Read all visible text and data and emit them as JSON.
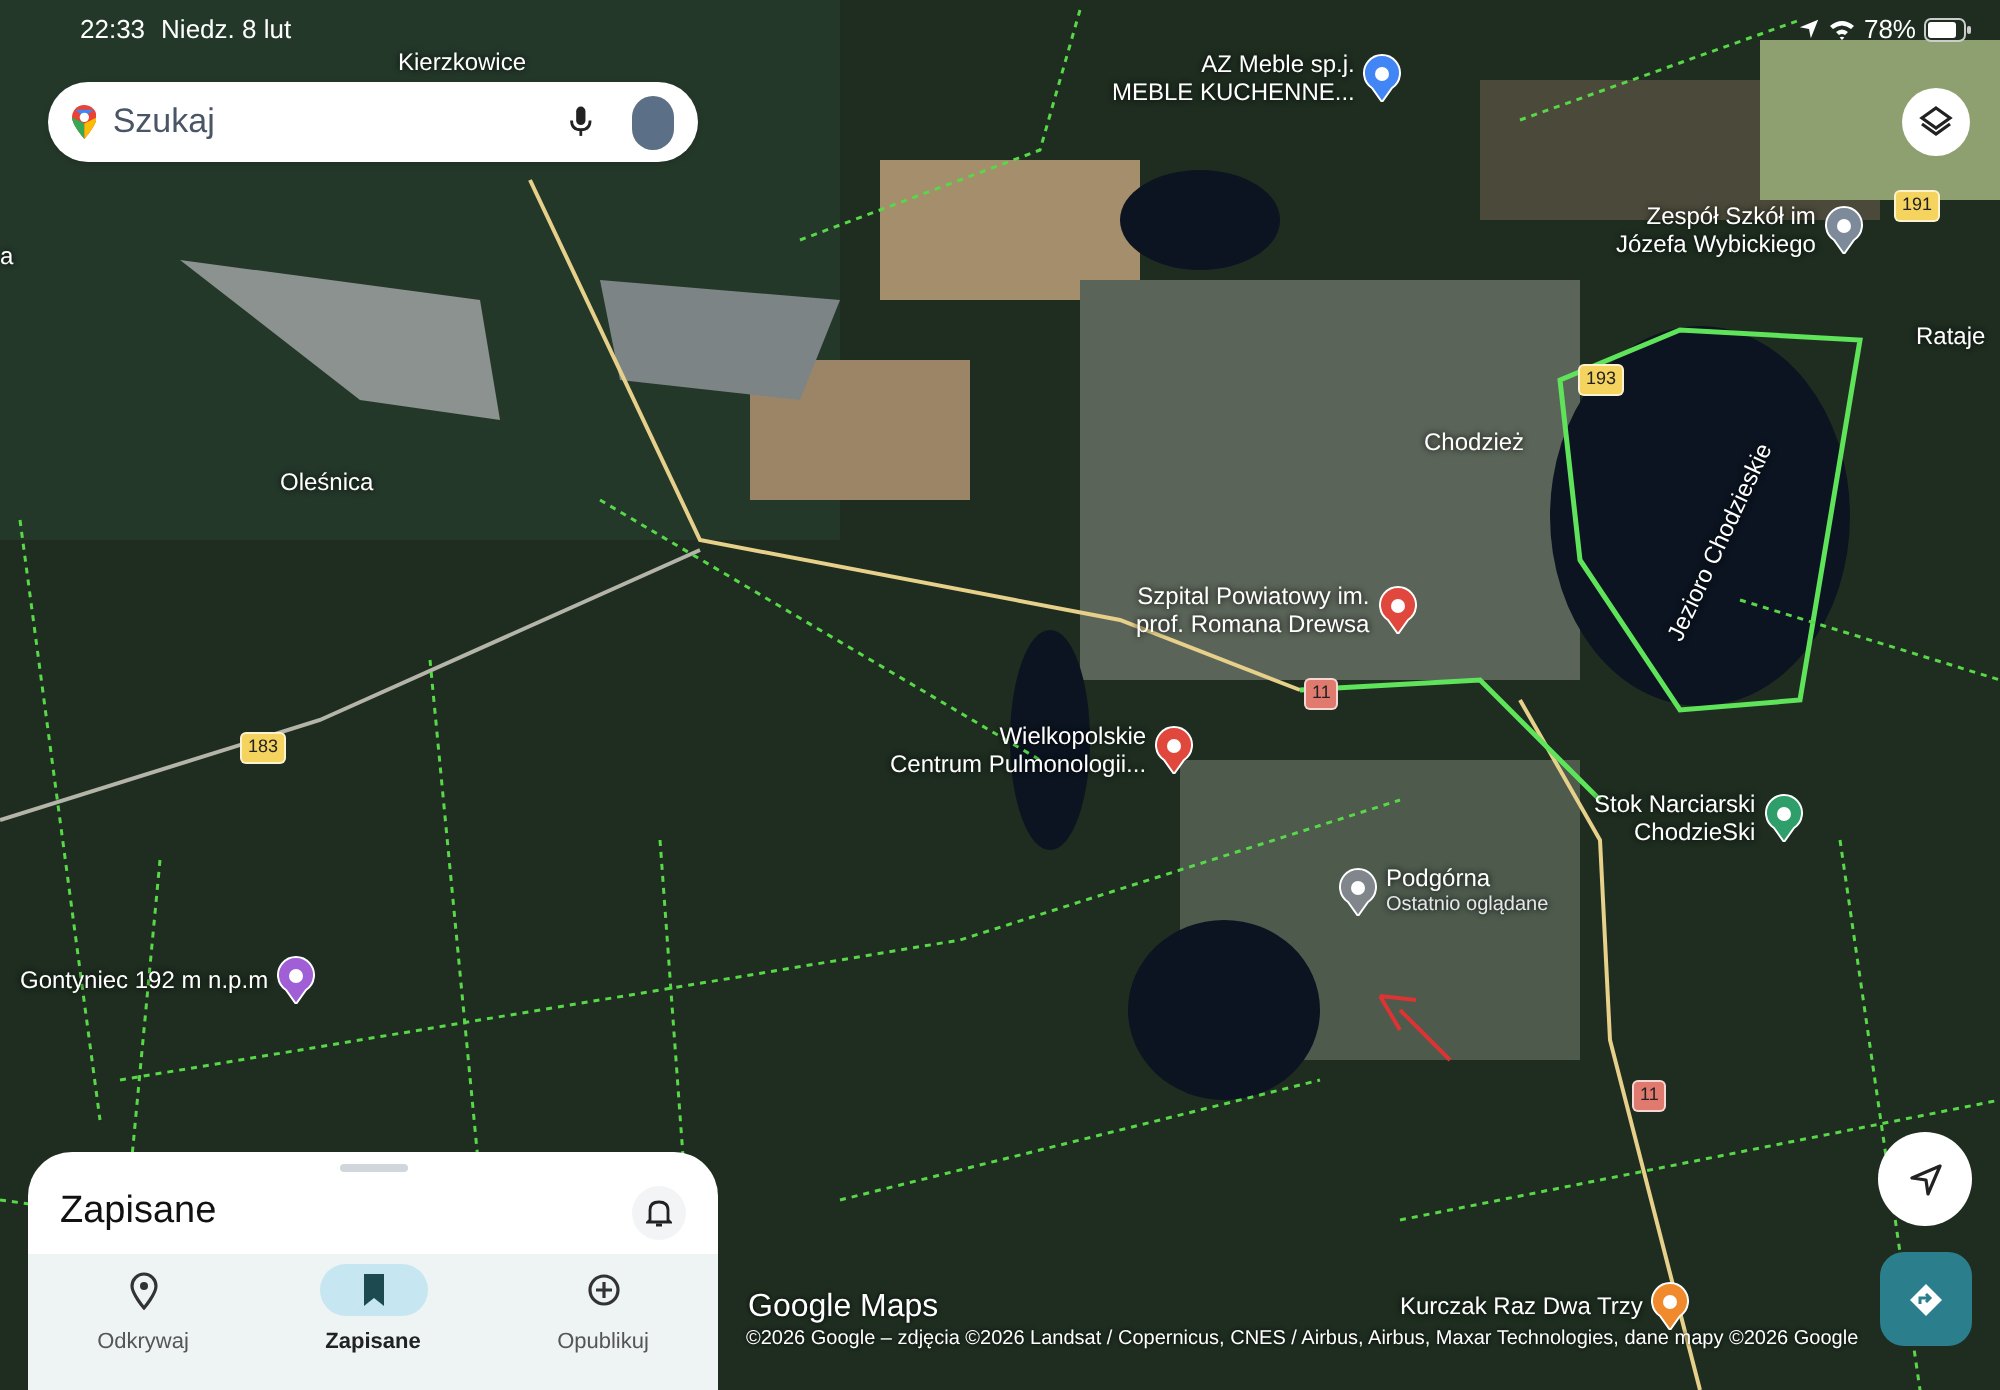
{
  "status_bar": {
    "time": "22:33",
    "date": "Niedz. 8 lut",
    "battery": "78%"
  },
  "search": {
    "placeholder": "Szukaj"
  },
  "map_labels": [
    {
      "kind": "place",
      "lines": [
        "Kierzkowice"
      ]
    },
    {
      "kind": "place",
      "lines": [
        "a"
      ]
    },
    {
      "kind": "place",
      "lines": [
        "Oleśnica"
      ]
    },
    {
      "kind": "poi",
      "lines": [
        "AZ Meble sp.j.",
        "MEBLE KUCHENNE..."
      ],
      "color": "#4285f4"
    },
    {
      "kind": "poi",
      "lines": [
        "Zespół Szkół im",
        "Józefa Wybickiego"
      ],
      "color": "#7d8a99"
    },
    {
      "kind": "place",
      "lines": [
        "Rataje"
      ]
    },
    {
      "kind": "road",
      "lines": [
        "191"
      ],
      "color": "#f4d35e"
    },
    {
      "kind": "road",
      "lines": [
        "193"
      ],
      "color": "#f4d35e"
    },
    {
      "kind": "place",
      "lines": [
        "Chodzież"
      ]
    },
    {
      "kind": "water",
      "lines": [
        "Jezioro Chodzieskie"
      ]
    },
    {
      "kind": "poi",
      "lines": [
        "Szpital Powiatowy im.",
        "prof. Romana Drewsa"
      ],
      "color": "#e0483e"
    },
    {
      "kind": "road",
      "lines": [
        "11"
      ],
      "color": "#e07a6e"
    },
    {
      "kind": "road",
      "lines": [
        "183"
      ],
      "color": "#f4d35e"
    },
    {
      "kind": "poi",
      "lines": [
        "Wielkopolskie",
        "Centrum Pulmonologii..."
      ],
      "color": "#e0483e"
    },
    {
      "kind": "poi",
      "lines": [
        "Stok Narciarski",
        "ChodzieSki"
      ],
      "color": "#2e9e6a"
    },
    {
      "kind": "poi",
      "lines": [
        "Podgórna",
        "Ostatnio oglądane"
      ],
      "color": "#80868b"
    },
    {
      "kind": "poi",
      "lines": [
        "Gontyniec 192 m n.p.m"
      ],
      "color": "#a05fd6"
    },
    {
      "kind": "road",
      "lines": [
        "11"
      ],
      "color": "#e07a6e"
    },
    {
      "kind": "poi",
      "lines": [
        "Kurczak Raz Dwa Trzy"
      ],
      "color": "#f08a2c"
    }
  ],
  "map_brand": "Google Maps",
  "attribution": "©2026 Google – zdjęcia ©2026 Landsat / Copernicus, CNES / Airbus, Airbus, Maxar Technologies, dane mapy ©2026 Google",
  "sheet": {
    "title": "Zapisane",
    "tabs": [
      {
        "label": "Odkrywaj",
        "selected": false
      },
      {
        "label": "Zapisane",
        "selected": true
      },
      {
        "label": "Opublikuj",
        "selected": false
      }
    ]
  }
}
